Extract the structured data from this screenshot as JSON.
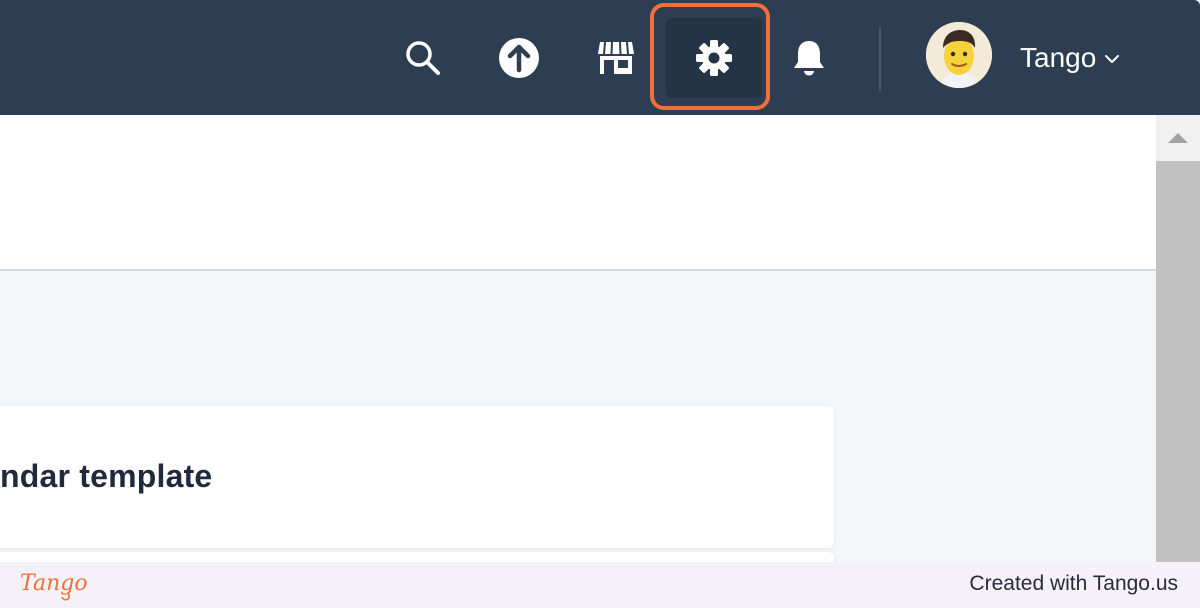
{
  "nav": {
    "icons": {
      "search": "search-icon",
      "upload": "upload-icon",
      "marketplace": "marketplace-icon",
      "settings": "gear-icon",
      "notifications": "bell-icon"
    },
    "user": {
      "name": "Tango"
    }
  },
  "content": {
    "card_title": "ndar template"
  },
  "footer": {
    "brand": "Tango",
    "text": "Created with Tango.us"
  },
  "colors": {
    "nav_bg": "#2e3e52",
    "highlight": "#f0703c",
    "page_bg": "#f4f6f9"
  }
}
